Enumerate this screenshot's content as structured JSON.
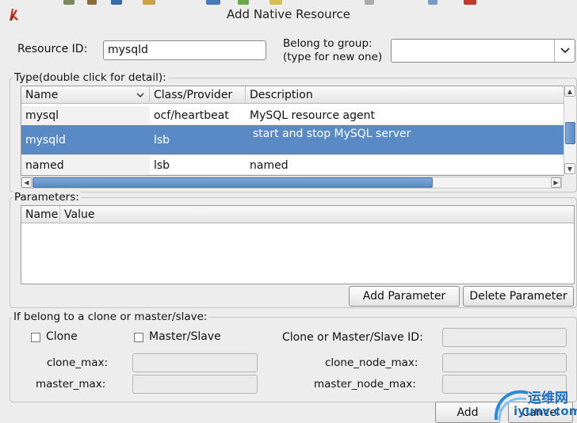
{
  "window": {
    "title": "Add Native Resource"
  },
  "resource": {
    "id_label": "Resource ID:",
    "id_value": "mysqld",
    "group_label_1": "Belong to group:",
    "group_label_2": "(type for new one)",
    "group_value": ""
  },
  "type_section": {
    "title": "Type(double click for detail):",
    "columns": [
      "Name",
      "Class/Provider",
      "Description"
    ],
    "rows": [
      {
        "name": "mysql",
        "provider": "ocf/heartbeat",
        "description": "MySQL resource agent"
      },
      {
        "name": "mysqld",
        "provider": "lsb",
        "description": "start and stop MySQL server"
      },
      {
        "name": "named",
        "provider": "lsb",
        "description": "named"
      }
    ]
  },
  "parameters": {
    "title": "Parameters:",
    "columns": [
      "Name",
      "Value"
    ],
    "add_button": "Add Parameter",
    "delete_button": "Delete Parameter"
  },
  "clone_section": {
    "title": "If belong to a clone or master/slave:",
    "clone_label": "Clone",
    "master_slave_label": "Master/Slave",
    "id_label": "Clone or Master/Slave ID:",
    "clone_max_label": "clone_max:",
    "clone_node_max_label": "clone_node_max:",
    "master_max_label": "master_max:",
    "master_node_max_label": "master_node_max:"
  },
  "footer": {
    "add_button": "Add",
    "cancel_button": "Cancel"
  },
  "watermark": {
    "text_cn": "运维网",
    "text_url": "iyunv.com"
  },
  "colors": {
    "selection": "#5a8ac6",
    "app_icon": "#c0392b"
  }
}
